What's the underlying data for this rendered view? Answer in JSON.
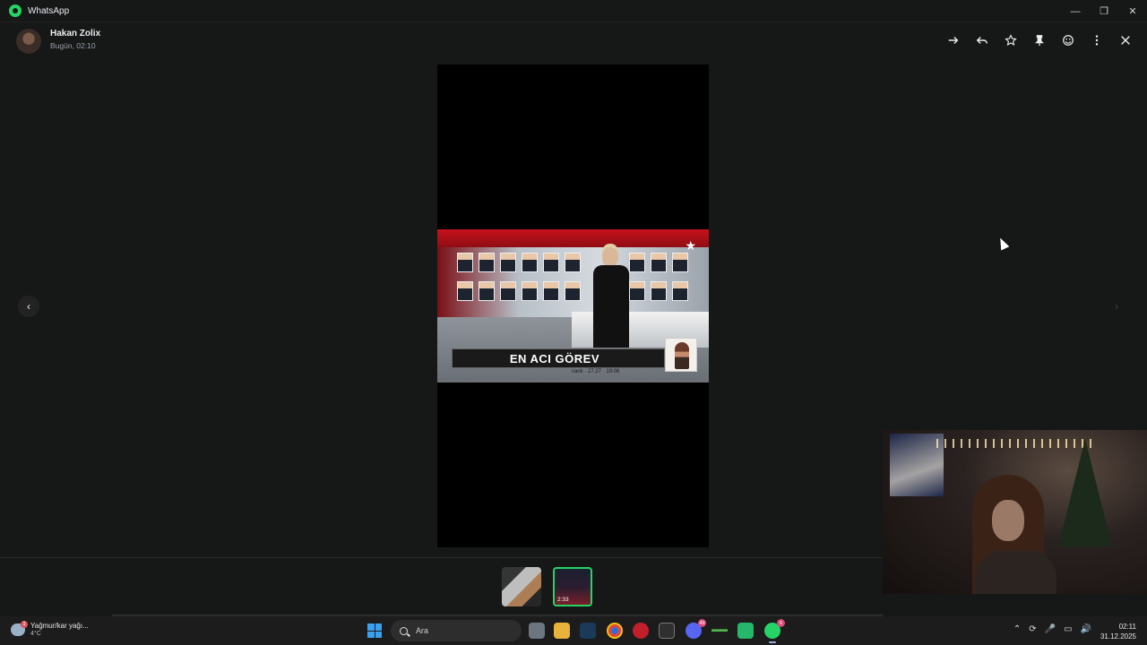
{
  "window": {
    "title": "WhatsApp",
    "controls": [
      "minimize",
      "restore",
      "close"
    ]
  },
  "viewer": {
    "sender_name": "Hakan Zolix",
    "sender_time": "Bugün, 02:10",
    "actions": [
      {
        "name": "forward-icon"
      },
      {
        "name": "reply-icon"
      },
      {
        "name": "star-icon"
      },
      {
        "name": "pin-icon"
      },
      {
        "name": "emoji-icon"
      },
      {
        "name": "more-icon"
      },
      {
        "name": "close-icon"
      }
    ],
    "video_headline": "EN ACI GÖREV",
    "video_ticker": "canlı · 27.27 · 19:06"
  },
  "thumbnails": [
    {
      "kind": "image",
      "selected": false
    },
    {
      "kind": "video",
      "duration": "2:33",
      "selected": true
    }
  ],
  "taskbar": {
    "weather_desc": "Yağmur/kar yağı...",
    "weather_temp": "4°C",
    "weather_badge": "1",
    "search_placeholder": "Ara",
    "discord_badge": "49",
    "whatsapp_badge": "6",
    "time": "02:11",
    "date": "31.12.2025"
  },
  "colors": {
    "background": "#161717",
    "accent": "#25d366"
  }
}
